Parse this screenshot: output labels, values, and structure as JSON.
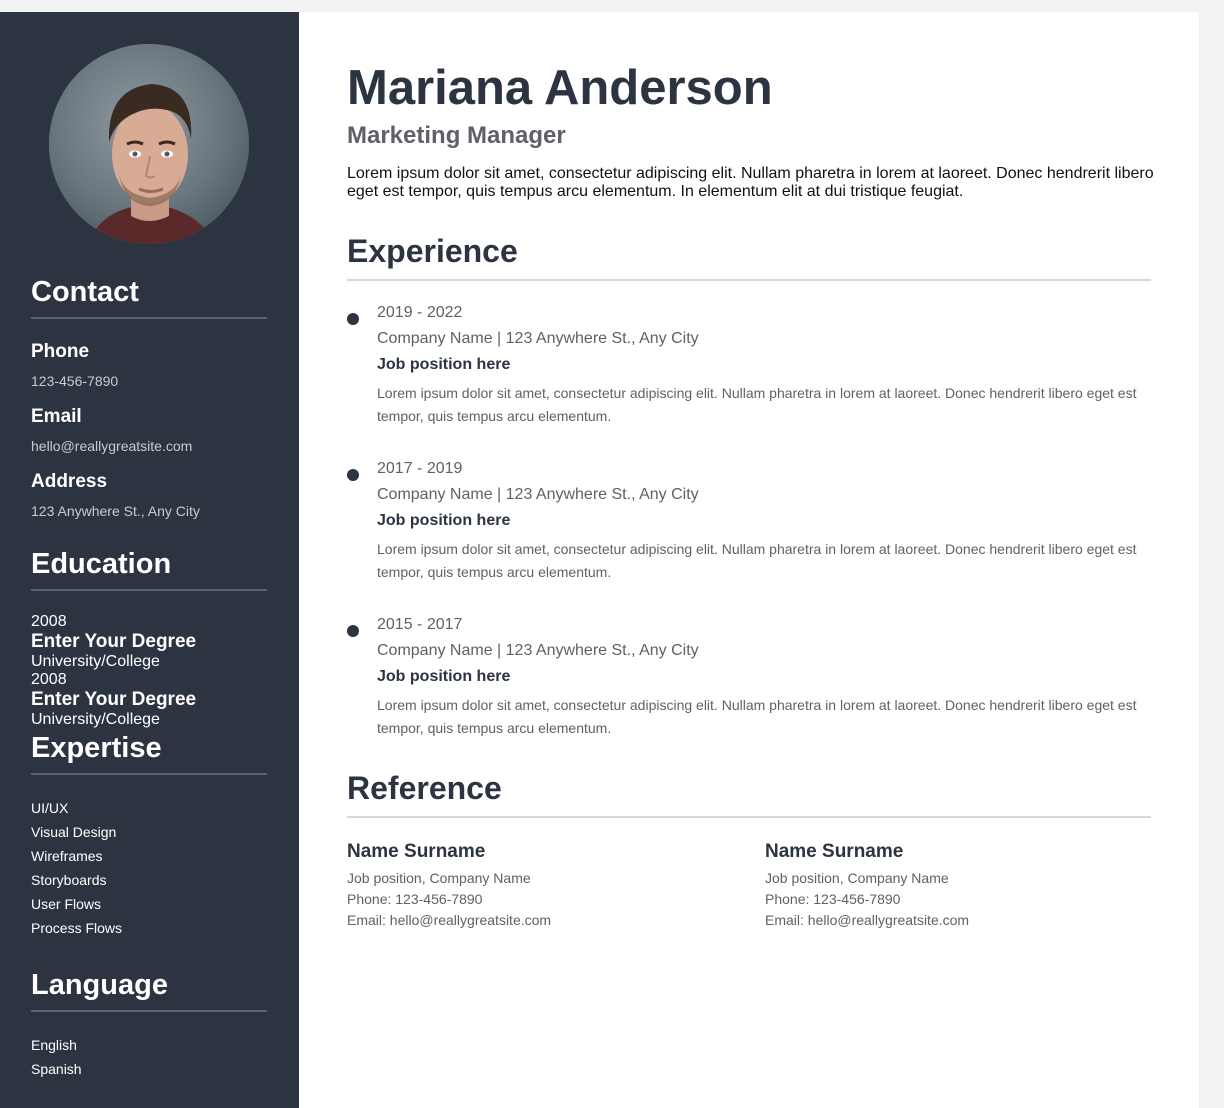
{
  "profile": {
    "name": "Mariana Anderson",
    "role": "Marketing Manager",
    "summary": "Lorem ipsum dolor sit amet, consectetur adipiscing elit. Nullam pharetra in lorem at laoreet. Donec hendrerit libero eget est tempor, quis tempus arcu elementum. In elementum elit at dui tristique feugiat."
  },
  "sidebar": {
    "contact": {
      "title": "Contact",
      "phone_label": "Phone",
      "phone": "123-456-7890",
      "email_label": "Email",
      "email": "hello@reallygreatsite.com",
      "address_label": "Address",
      "address": "123 Anywhere St., Any City"
    },
    "education": {
      "title": "Education",
      "items": [
        {
          "year": "2008",
          "degree": "Enter Your Degree",
          "school": "University/College"
        },
        {
          "year": "2008",
          "degree": "Enter Your Degree",
          "school": "University/College"
        }
      ]
    },
    "expertise": {
      "title": "Expertise",
      "items": [
        "UI/UX",
        "Visual Design",
        "Wireframes",
        "Storyboards",
        "User Flows",
        "Process Flows"
      ]
    },
    "language": {
      "title": "Language",
      "items": [
        "English",
        "Spanish"
      ]
    }
  },
  "experience": {
    "title": "Experience",
    "items": [
      {
        "years": "2019 - 2022",
        "company": "Company Name | 123 Anywhere St., Any City",
        "position": "Job position here",
        "description": "Lorem ipsum dolor sit amet, consectetur adipiscing elit. Nullam pharetra in lorem at laoreet. Donec hendrerit libero eget est tempor, quis tempus arcu elementum."
      },
      {
        "years": "2017 - 2019",
        "company": "Company Name | 123 Anywhere St., Any City",
        "position": "Job position here",
        "description": "Lorem ipsum dolor sit amet, consectetur adipiscing elit. Nullam pharetra in lorem at laoreet. Donec hendrerit libero eget est tempor, quis tempus arcu elementum."
      },
      {
        "years": "2015 - 2017",
        "company": "Company Name | 123 Anywhere St., Any City",
        "position": "Job position here",
        "description": "Lorem ipsum dolor sit amet, consectetur adipiscing elit. Nullam pharetra in lorem at laoreet. Donec hendrerit libero eget est tempor, quis tempus arcu elementum."
      }
    ]
  },
  "reference": {
    "title": "Reference",
    "items": [
      {
        "name": "Name Surname",
        "position": "Job position, Company Name",
        "phone": "Phone: 123-456-7890",
        "email": "Email: hello@reallygreatsite.com"
      },
      {
        "name": "Name Surname",
        "position": "Job position, Company Name",
        "phone": "Phone: 123-456-7890",
        "email": "Email: hello@reallygreatsite.com"
      }
    ]
  },
  "colors": {
    "sidebar_bg": "#2d3441",
    "heading": "#2d3441",
    "muted_text": "#5e6168",
    "rule": "#d6d8db"
  }
}
